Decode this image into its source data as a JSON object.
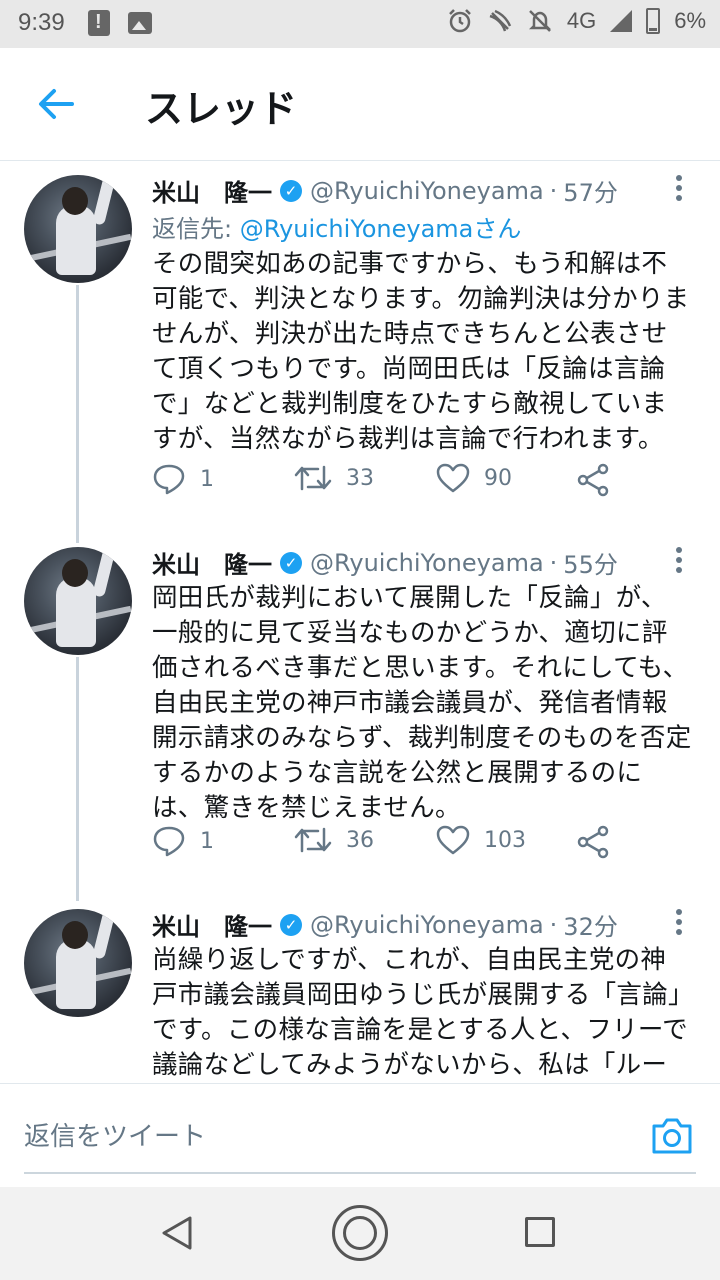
{
  "status_bar": {
    "time": "9:39",
    "network": "4G",
    "battery": "6%",
    "icons": [
      "alert-icon",
      "image-icon",
      "alarm-icon",
      "nfc-icon",
      "mute-icon",
      "signal-icon",
      "battery-icon"
    ]
  },
  "header": {
    "title": "スレッド",
    "back_icon": "arrow-left-icon"
  },
  "tweets": [
    {
      "name": "米山　隆一",
      "handle": "@RyuichiYoneyama",
      "time": "57分",
      "reply_to_label": "返信先: ",
      "reply_to_handle": "@RyuichiYoneyamaさん",
      "body": "その間突如あの記事ですから、もう和解は不可能で、判決となります。勿論判決は分かりませんが、判決が出た時点できちんと公表させて頂くつもりです。尚岡田氏は「反論は言論で」などと裁判制度をひたすら敵視していますが、当然ながら裁判は言論で行われます。",
      "replies": "1",
      "retweets": "33",
      "likes": "90"
    },
    {
      "name": "米山　隆一",
      "handle": "@RyuichiYoneyama",
      "time": "55分",
      "body": "岡田氏が裁判において展開した「反論」が、一般的に見て妥当なものかどうか、適切に評価されるべき事だと思います。それにしても、自由民主党の神戸市議会議員が、発信者情報開示請求のみならず、裁判制度そのものを否定するかのような言説を公然と展開するのには、驚きを禁じえません。",
      "replies": "1",
      "retweets": "36",
      "likes": "103"
    },
    {
      "name": "米山　隆一",
      "handle": "@RyuichiYoneyama",
      "time": "32分",
      "body": "尚繰り返しですが、これが、自由民主党の神戸市議会議員岡田ゆうじ氏が展開する「言論」です。この様な言論を是とする人と、フリーで議論などしてみようがないから、私は「ルールと審判のいる言論」である裁判に訴えただけで"
    }
  ],
  "reply_bar": {
    "placeholder": "返信をツイート"
  },
  "colors": {
    "accent": "#1da1f2",
    "text": "#14171a",
    "secondary": "#657786"
  }
}
